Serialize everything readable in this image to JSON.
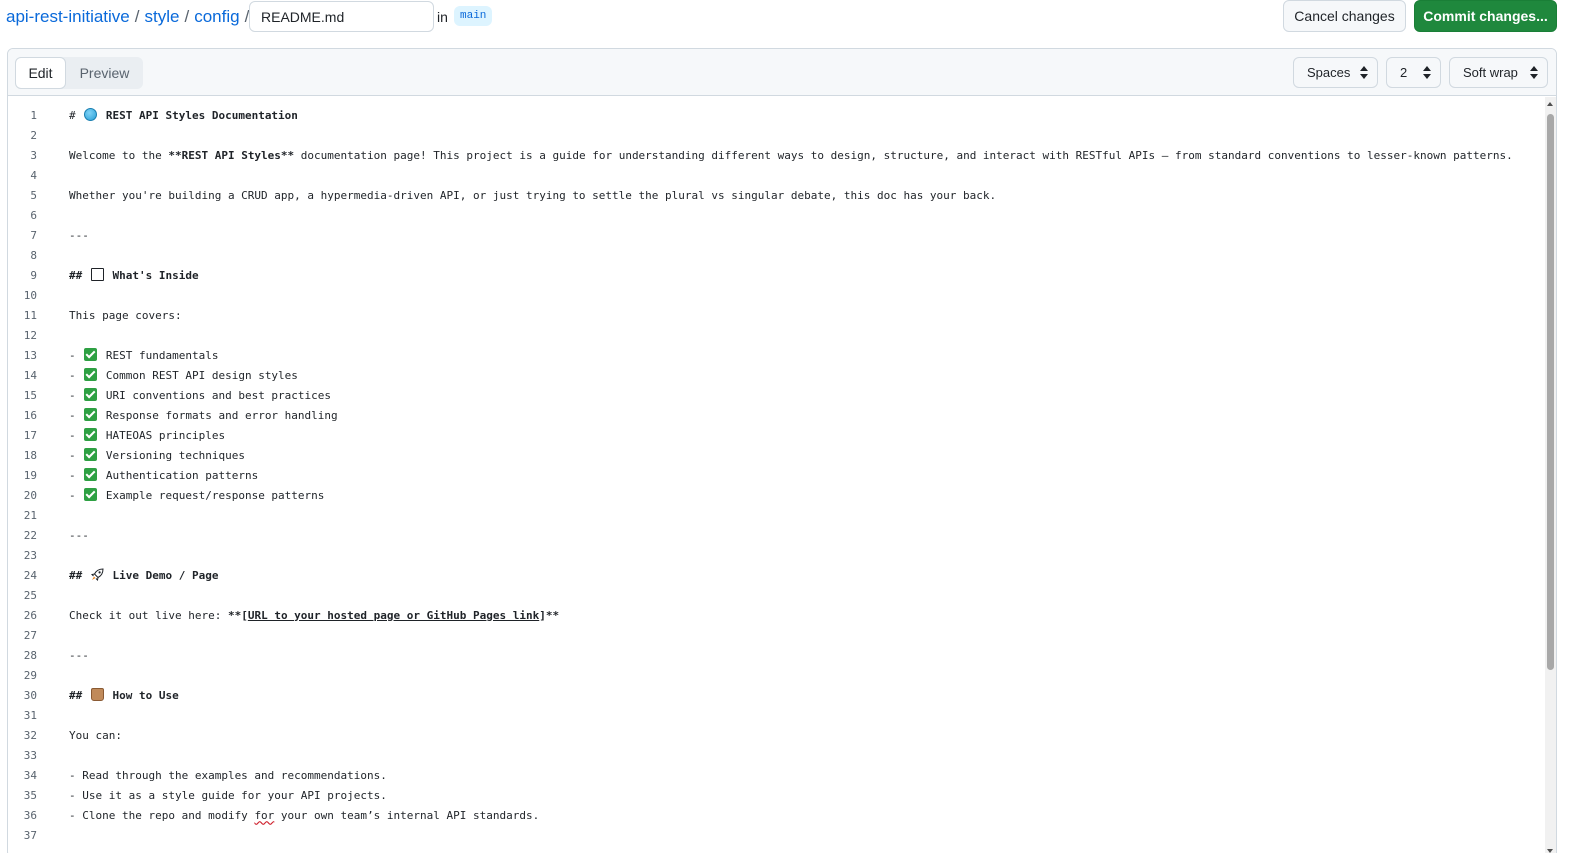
{
  "breadcrumb": {
    "repo": "api-rest-initiative",
    "folders": [
      "style",
      "config"
    ],
    "separator": "/",
    "filename": "README.md",
    "in_label": "in",
    "branch": "main"
  },
  "actions": {
    "cancel_label": "Cancel changes",
    "commit_label": "Commit changes..."
  },
  "editor": {
    "tabs": {
      "edit": "Edit",
      "preview": "Preview",
      "active": "Edit"
    },
    "indent_mode": "Spaces",
    "indent_size": "2",
    "wrap_mode": "Soft wrap"
  },
  "lines": [
    {
      "n": "1",
      "segs": [
        {
          "t": "# "
        },
        {
          "icon": "globe-icon"
        },
        {
          "t": " REST API Styles Documentation",
          "b": true
        }
      ]
    },
    {
      "n": "2",
      "segs": []
    },
    {
      "n": "3",
      "segs": [
        {
          "t": "Welcome to the "
        },
        {
          "t": "**REST API Styles**",
          "b": true
        },
        {
          "t": " documentation page! This project is a guide for understanding different ways to design, structure, and interact with RESTful APIs — from standard conventions to lesser-known patterns."
        }
      ]
    },
    {
      "n": "4",
      "segs": []
    },
    {
      "n": "5",
      "segs": [
        {
          "t": "Whether you're building a CRUD app, a hypermedia-driven API, or just trying to settle the plural vs singular debate, this doc has your back."
        }
      ]
    },
    {
      "n": "6",
      "segs": []
    },
    {
      "n": "7",
      "segs": [
        {
          "t": "---"
        }
      ]
    },
    {
      "n": "8",
      "segs": []
    },
    {
      "n": "9",
      "segs": [
        {
          "t": "## ",
          "b": true
        },
        {
          "icon": "book-icon"
        },
        {
          "t": " What's Inside",
          "b": true
        }
      ]
    },
    {
      "n": "10",
      "segs": []
    },
    {
      "n": "11",
      "segs": [
        {
          "t": "This page covers:"
        }
      ]
    },
    {
      "n": "12",
      "segs": []
    },
    {
      "n": "13",
      "segs": [
        {
          "t": "- "
        },
        {
          "icon": "check-icon"
        },
        {
          "t": " REST fundamentals"
        }
      ]
    },
    {
      "n": "14",
      "segs": [
        {
          "t": "- "
        },
        {
          "icon": "check-icon"
        },
        {
          "t": " Common REST API design styles"
        }
      ]
    },
    {
      "n": "15",
      "segs": [
        {
          "t": "- "
        },
        {
          "icon": "check-icon"
        },
        {
          "t": " URI conventions and best practices"
        }
      ]
    },
    {
      "n": "16",
      "segs": [
        {
          "t": "- "
        },
        {
          "icon": "check-icon"
        },
        {
          "t": " Response formats and error handling"
        }
      ]
    },
    {
      "n": "17",
      "segs": [
        {
          "t": "- "
        },
        {
          "icon": "check-icon"
        },
        {
          "t": " HATEOAS principles"
        }
      ]
    },
    {
      "n": "18",
      "segs": [
        {
          "t": "- "
        },
        {
          "icon": "check-icon"
        },
        {
          "t": " Versioning techniques"
        }
      ]
    },
    {
      "n": "19",
      "segs": [
        {
          "t": "- "
        },
        {
          "icon": "check-icon"
        },
        {
          "t": " Authentication patterns"
        }
      ]
    },
    {
      "n": "20",
      "segs": [
        {
          "t": "- "
        },
        {
          "icon": "check-icon"
        },
        {
          "t": " Example request/response patterns"
        }
      ]
    },
    {
      "n": "21",
      "segs": []
    },
    {
      "n": "22",
      "segs": [
        {
          "t": "---"
        }
      ]
    },
    {
      "n": "23",
      "segs": []
    },
    {
      "n": "24",
      "segs": [
        {
          "t": "## ",
          "b": true
        },
        {
          "icon": "rocket-icon"
        },
        {
          "t": " Live Demo / Page",
          "b": true
        }
      ]
    },
    {
      "n": "25",
      "segs": []
    },
    {
      "n": "26",
      "segs": [
        {
          "t": "Check it out live here: "
        },
        {
          "t": "**[",
          "b": true
        },
        {
          "t": "URL to your hosted page or GitHub Pages link",
          "u": true
        },
        {
          "t": "]**",
          "b": true
        }
      ]
    },
    {
      "n": "27",
      "segs": []
    },
    {
      "n": "28",
      "segs": [
        {
          "t": "---"
        }
      ]
    },
    {
      "n": "29",
      "segs": []
    },
    {
      "n": "30",
      "segs": [
        {
          "t": "## ",
          "b": true
        },
        {
          "icon": "shopping-bag-icon"
        },
        {
          "t": " How to Use",
          "b": true
        }
      ]
    },
    {
      "n": "31",
      "segs": []
    },
    {
      "n": "32",
      "segs": [
        {
          "t": "You can:"
        }
      ]
    },
    {
      "n": "33",
      "segs": []
    },
    {
      "n": "34",
      "segs": [
        {
          "t": "- Read through the examples and recommendations."
        }
      ]
    },
    {
      "n": "35",
      "segs": [
        {
          "t": "- Use it as a style guide for your API projects."
        }
      ]
    },
    {
      "n": "36",
      "segs": [
        {
          "t": "- Clone the repo and modify "
        },
        {
          "t": "for",
          "sq": true
        },
        {
          "t": " your own team’s internal API standards."
        }
      ]
    },
    {
      "n": "37",
      "segs": []
    }
  ]
}
